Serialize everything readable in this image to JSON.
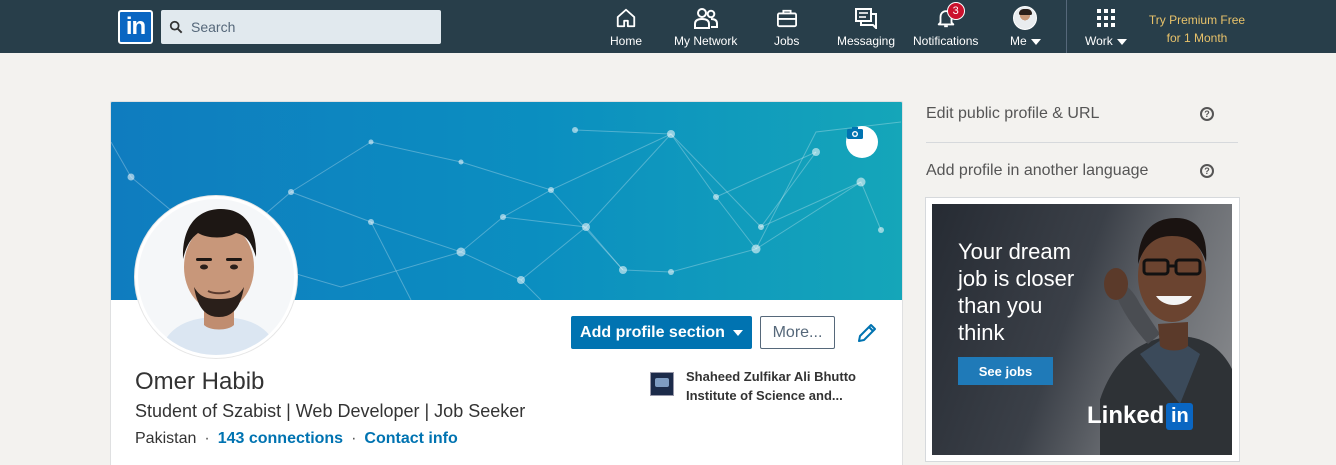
{
  "colors": {
    "nav_bg": "#283e4a",
    "brand_blue": "#0073b1",
    "premium_gold": "#e8c26a",
    "notification_red": "#cb112d",
    "page_bg": "#f3f2ef"
  },
  "topnav": {
    "logo_text": "in",
    "search": {
      "placeholder": "Search",
      "icon": "search-icon"
    },
    "items": [
      {
        "label": "Home",
        "icon": "home-icon"
      },
      {
        "label": "My Network",
        "icon": "network-icon"
      },
      {
        "label": "Jobs",
        "icon": "briefcase-icon"
      },
      {
        "label": "Messaging",
        "icon": "messaging-icon"
      },
      {
        "label": "Notifications",
        "icon": "bell-icon",
        "badge": "3"
      },
      {
        "label": "Me",
        "icon": "avatar"
      },
      {
        "label": "Work",
        "icon": "grid-icon"
      }
    ],
    "premium": {
      "line1": "Try Premium Free",
      "line2": "for 1 Month"
    }
  },
  "profile": {
    "name": "Omer Habib",
    "headline": "Student of Szabist | Web Developer | Job Seeker",
    "location": "Pakistan",
    "separator": "·",
    "connections": "143 connections",
    "contact": "Contact info",
    "add_section_label": "Add profile section",
    "more_label": "More...",
    "education": {
      "line1": "Shaheed Zulfikar Ali Bhutto",
      "line2": "Institute of Science and..."
    }
  },
  "rail": {
    "edit_url": "Edit public profile & URL",
    "add_language": "Add profile in another language",
    "help_glyph": "?"
  },
  "ad": {
    "line1": "Your dream",
    "line2": "job is closer",
    "line3": "than you",
    "line4": "think",
    "button": "See jobs",
    "brand": "Linked",
    "brand_in": "in"
  }
}
